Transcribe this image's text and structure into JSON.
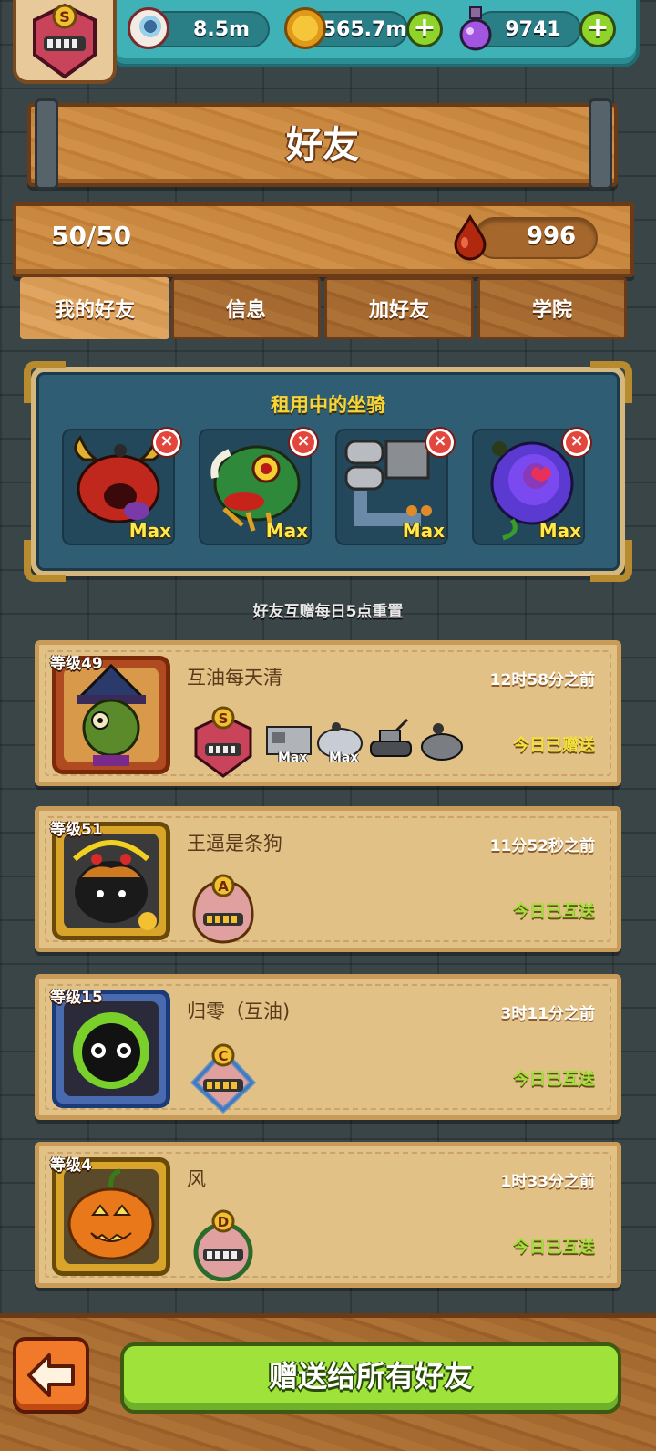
{
  "resources": {
    "eyeballs": "8.5m",
    "coins": "565.7m",
    "potions": "9741",
    "add_symbol": "+"
  },
  "profile": {
    "rank": "S"
  },
  "header": {
    "title": "好友"
  },
  "friend_count": {
    "value": "50/50",
    "blood_drops": "996"
  },
  "tabs": [
    {
      "label": "我的好友",
      "active": true
    },
    {
      "label": "信息",
      "active": false
    },
    {
      "label": "加好友",
      "active": false
    },
    {
      "label": "学院",
      "active": false
    }
  ],
  "rented_mounts": {
    "title": "租用中的坐骑",
    "close_symbol": "×",
    "items": [
      {
        "icon": "red-horned-monster-mount",
        "badge": "Max"
      },
      {
        "icon": "lion-dance-mount",
        "badge": "Max"
      },
      {
        "icon": "pipe-machine-mount",
        "badge": "Max"
      },
      {
        "icon": "purple-rose-mount",
        "badge": "Max"
      }
    ]
  },
  "reset_note": "好友互赠每日5点重置",
  "friends": [
    {
      "level": "等级49",
      "name": "互油每天清",
      "time": "12时58分之前",
      "status": "今日已赠送",
      "status_color": "#f4e23a",
      "rank": "S",
      "rank_color": "#c9435a",
      "avatar": "green-witch-avatar",
      "mounts": [
        {
          "icon": "machine-mount",
          "badge": "Max"
        },
        {
          "icon": "cloud-mount",
          "badge": "Max"
        },
        {
          "icon": "tank-mount",
          "badge": ""
        },
        {
          "icon": "turtle-mount",
          "badge": ""
        }
      ]
    },
    {
      "level": "等级51",
      "name": "王逼是条狗",
      "time": "11分52秒之前",
      "status": "今日已互送",
      "status_color": "#9ee23a",
      "rank": "A",
      "rank_color": "#d9a23a",
      "avatar": "black-cat-demon-avatar",
      "mounts": []
    },
    {
      "level": "等级15",
      "name": "归零（互油)",
      "time": "3时11分之前",
      "status": "今日已互送",
      "status_color": "#9ee23a",
      "rank": "C",
      "rank_color": "#4a8ad0",
      "avatar": "green-fuzzball-avatar",
      "mounts": []
    },
    {
      "level": "等级4",
      "name": "风",
      "time": "1时33分之前",
      "status": "今日已互送",
      "status_color": "#9ee23a",
      "rank": "D",
      "rank_color": "#4aa04a",
      "avatar": "pumpkin-avatar",
      "mounts": []
    }
  ],
  "footer": {
    "send_all_label": "赠送给所有好友",
    "back_icon": "back-arrow-icon"
  }
}
